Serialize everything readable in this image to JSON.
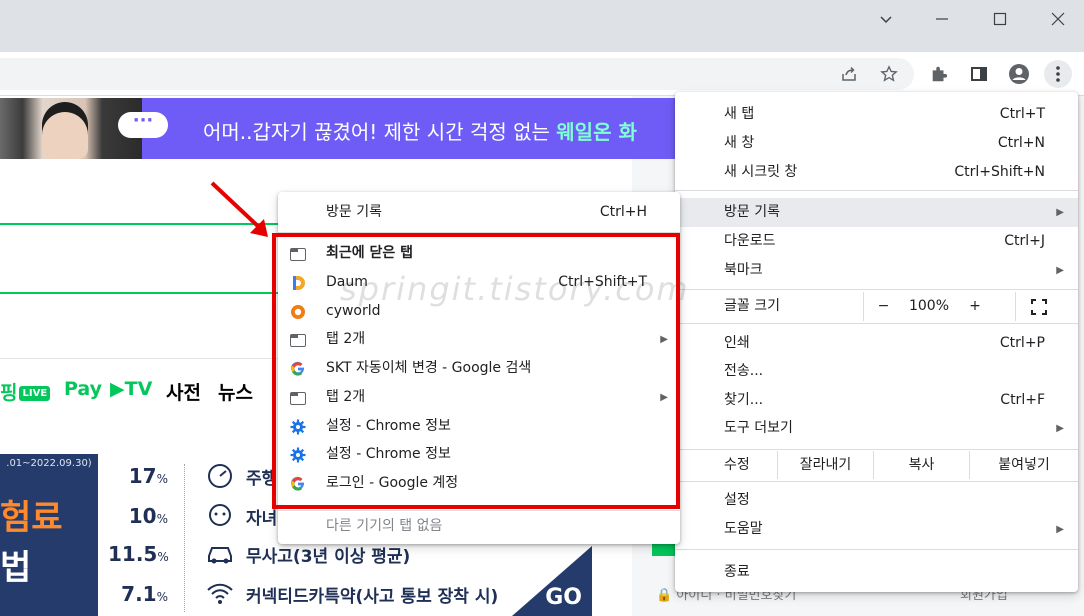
{
  "window": {
    "controls": [
      "chevron-down",
      "minimize",
      "maximize",
      "close"
    ]
  },
  "toolbar": {
    "icons": [
      "share-icon",
      "bookmark-star-icon",
      "extensions-icon",
      "side-panel-icon",
      "profile-icon",
      "more-menu-icon"
    ]
  },
  "page": {
    "banner_text": "어머..갑자기 끊겼어! 제한 시간 걱정 없는 ",
    "banner_accent": "웨일온 화",
    "banner_bubble": "···",
    "nav": {
      "live_prefix": "핑",
      "live_badge": "LIVE",
      "pay": "Pay",
      "tv": "▶TV",
      "dict": "사전",
      "news": "뉴스"
    },
    "ad": {
      "period": ".01~2022.09.30)",
      "big1": "험료",
      "big2": "법",
      "rows": [
        {
          "pct": "17",
          "unit": "%",
          "label": "주행"
        },
        {
          "pct": "10",
          "unit": "%",
          "label": "자녀"
        },
        {
          "pct": "11.5",
          "unit": "%",
          "label": "무사고(3년 이상 평균)"
        },
        {
          "pct": "7.1",
          "unit": "%",
          "label": "커넥티드카특약(사고 통보 장착 시)"
        }
      ],
      "go": "GO"
    },
    "login_text": "아이디 · 비밀번호찾기",
    "signup_text": "회원가입"
  },
  "main_menu": {
    "items": [
      {
        "label": "새 탭",
        "shortcut": "Ctrl+T"
      },
      {
        "label": "새 창",
        "shortcut": "Ctrl+N"
      },
      {
        "label": "새 시크릿 창",
        "shortcut": "Ctrl+Shift+N"
      },
      {
        "label": "방문 기록",
        "shortcut": ""
      },
      {
        "label": "다운로드",
        "shortcut": "Ctrl+J"
      },
      {
        "label": "북마크",
        "shortcut": ""
      },
      {
        "label": "인쇄",
        "shortcut": "Ctrl+P"
      },
      {
        "label": "전송...",
        "shortcut": ""
      },
      {
        "label": "찾기...",
        "shortcut": "Ctrl+F"
      },
      {
        "label": "도구 더보기",
        "shortcut": ""
      },
      {
        "label": "설정",
        "shortcut": ""
      },
      {
        "label": "도움말",
        "shortcut": ""
      },
      {
        "label": "종료",
        "shortcut": ""
      }
    ],
    "zoom": {
      "label": "글꼴 크기",
      "minus": "−",
      "value": "100%",
      "plus": "+"
    },
    "edit": {
      "label": "수정",
      "cut": "잘라내기",
      "copy": "복사",
      "paste": "붙여넣기"
    }
  },
  "history_menu": {
    "header": {
      "label": "방문 기록",
      "shortcut": "Ctrl+H"
    },
    "items": [
      {
        "label": "최근에 닫은 탭",
        "shortcut": "",
        "icon": "tab-icon"
      },
      {
        "label": "Daum",
        "shortcut": "Ctrl+Shift+T",
        "icon": "daum-icon"
      },
      {
        "label": "cyworld",
        "shortcut": "",
        "icon": "cyworld-icon"
      },
      {
        "label": "탭 2개",
        "shortcut": "",
        "icon": "tab-icon"
      },
      {
        "label": "SKT 자동이체 변경 - Google 검색",
        "shortcut": "",
        "icon": "google-icon"
      },
      {
        "label": "탭 2개",
        "shortcut": "",
        "icon": "tab-icon"
      },
      {
        "label": "설정 - Chrome 정보",
        "shortcut": "",
        "icon": "settings-gear-icon"
      },
      {
        "label": "설정 - Chrome 정보",
        "shortcut": "",
        "icon": "settings-gear-icon"
      },
      {
        "label": "로그인 - Google 계정",
        "shortcut": "",
        "icon": "google-icon"
      }
    ],
    "footer": "다른 기기의 탭 없음"
  },
  "watermark": "springit.tistory.com",
  "colors": {
    "highlight_red": "#e60000",
    "naver_green": "#03c75a",
    "banner_purple": "#6f5cf6",
    "menu_highlight": "#e8eaed"
  }
}
